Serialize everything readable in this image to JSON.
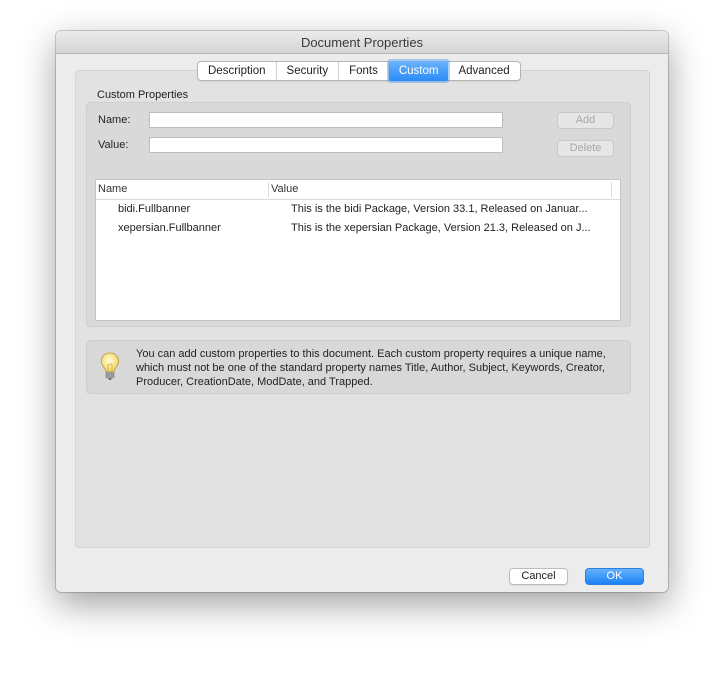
{
  "window": {
    "title": "Document Properties"
  },
  "tabs": [
    {
      "label": "Description",
      "active": false
    },
    {
      "label": "Security",
      "active": false
    },
    {
      "label": "Fonts",
      "active": false
    },
    {
      "label": "Custom",
      "active": true
    },
    {
      "label": "Advanced",
      "active": false
    }
  ],
  "custom": {
    "section_label": "Custom Properties",
    "name_label": "Name:",
    "name_value": "",
    "value_label": "Value:",
    "value_value": "",
    "add_label": "Add",
    "delete_label": "Delete",
    "table": {
      "columns": [
        "Name",
        "Value"
      ],
      "rows": [
        {
          "name": "bidi.Fullbanner",
          "value": "This is the bidi Package, Version 33.1, Released on Januar..."
        },
        {
          "name": "xepersian.Fullbanner",
          "value": "This is the xepersian Package, Version 21.3, Released on J..."
        }
      ]
    },
    "info_icon": "lightbulb-icon",
    "info_text": "You can add custom properties to this document. Each custom property requires a unique name, which must not be one of the standard property names Title, Author, Subject, Keywords, Creator, Producer, CreationDate, ModDate, and Trapped."
  },
  "footer": {
    "cancel_label": "Cancel",
    "ok_label": "OK"
  },
  "colors": {
    "accent": "#2a8cf7",
    "window_bg": "#ececec",
    "panel_bg": "#e2e2e2"
  }
}
